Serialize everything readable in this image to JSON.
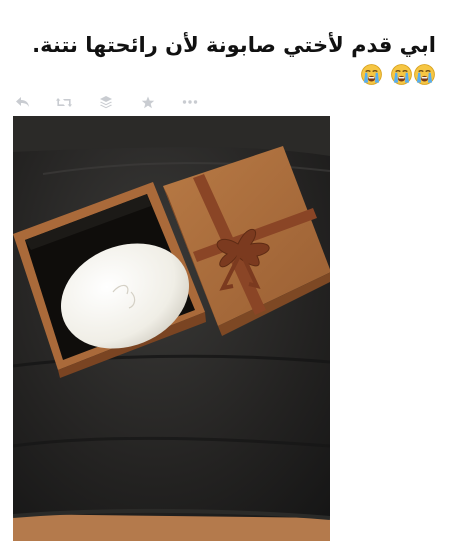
{
  "tweet": {
    "text": "ابي قدم لأختي صابونة لأن رائحتها نتنة.",
    "emoji": [
      "crying-face",
      "crying-face",
      "crying-face"
    ]
  },
  "actions": [
    "reply",
    "retweet",
    "stack",
    "favorite",
    "more"
  ],
  "colors": {
    "text": "#111111",
    "action_icon": "#c9ccd1",
    "leather": "#202020",
    "box": "#a8683a",
    "ribbon": "#8a4526",
    "soap": "#f1f0ea",
    "floor": "#b47a4c"
  }
}
